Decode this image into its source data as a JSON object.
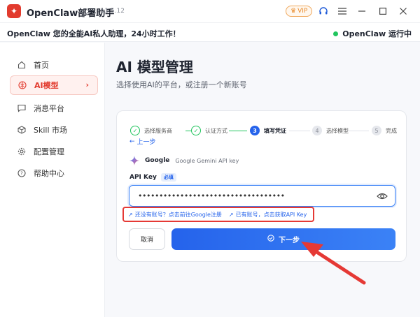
{
  "titlebar": {
    "title": "OpenClaw部署助手",
    "version": "v1.5.12",
    "vip_label": "VIP",
    "icons": [
      "headset-icon",
      "menu-icon",
      "minimize-icon",
      "maximize-icon",
      "close-icon"
    ]
  },
  "banner": {
    "text": "OpenClaw 您的全能AI私人助理，24小时工作！",
    "status": "OpenClaw 运行中",
    "status_color": "#22c55e"
  },
  "sidebar": {
    "items": [
      {
        "label": "首页",
        "icon": "home-icon"
      },
      {
        "label": "AI模型",
        "icon": "brain-icon",
        "active": true
      },
      {
        "label": "消息平台",
        "icon": "message-icon"
      },
      {
        "label": "Skill 市场",
        "icon": "cube-icon"
      },
      {
        "label": "配置管理",
        "icon": "gear-icon"
      },
      {
        "label": "帮助中心",
        "icon": "help-icon"
      }
    ]
  },
  "main": {
    "title": "AI 模型管理",
    "subtitle": "选择使用AI的平台，或注册一个新账号"
  },
  "wizard": {
    "steps": [
      {
        "num": "1",
        "label": "选择服务商",
        "state": "done"
      },
      {
        "num": "2",
        "label": "认证方式",
        "state": "done"
      },
      {
        "num": "3",
        "label": "填写凭证",
        "state": "current"
      },
      {
        "num": "4",
        "label": "选择模型",
        "state": "todo"
      },
      {
        "num": "5",
        "label": "完成",
        "state": "todo"
      }
    ],
    "back_label": "上一步",
    "provider_name": "Google",
    "provider_desc": "Google Gemini API key",
    "field_label": "API Key",
    "required_label": "必填",
    "api_key_value": "•••••••••••••••••••••••••••••••••••",
    "link_register": "还没有账号？点击前往Google注册",
    "link_get_key": "已有账号，点击获取API Key",
    "cancel_label": "取消",
    "next_label": "下一步"
  },
  "colors": {
    "accent": "#2563eb",
    "brand": "#e23b2e",
    "highlight_box": "#e53935"
  }
}
